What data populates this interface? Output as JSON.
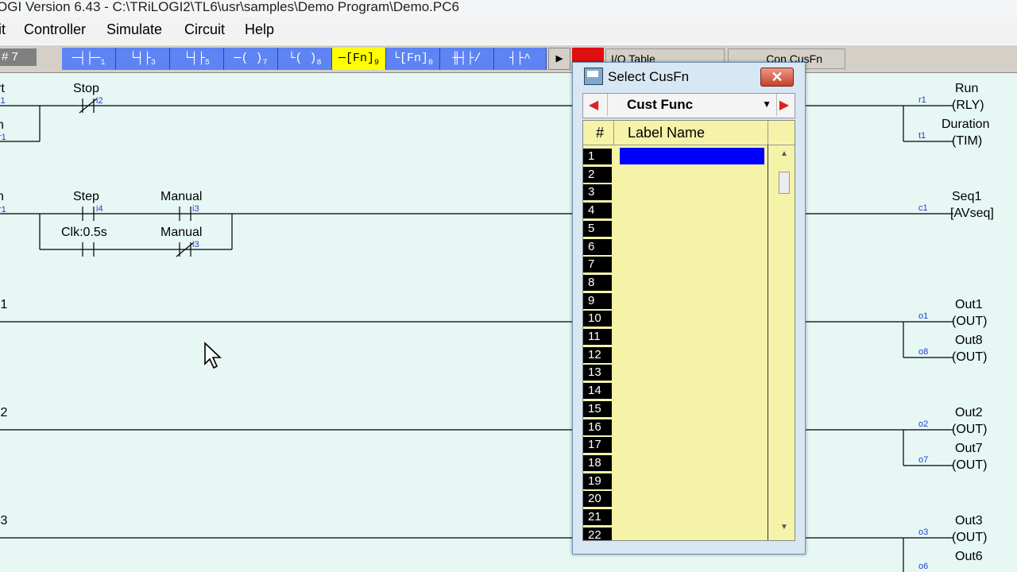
{
  "window": {
    "title": "OGI Version 6.43 - C:\\TRiLOGI2\\TL6\\usr\\samples\\Demo Program\\Demo.PC6"
  },
  "menu": {
    "items": [
      "it",
      "Controller",
      "Simulate",
      "Circuit",
      "Help"
    ]
  },
  "toolbar": {
    "rung_number": "# 7",
    "buttons": [
      {
        "label": "─┤├─",
        "sub": "1",
        "icon": "contact-series-icon"
      },
      {
        "label": "└┤├",
        "sub": "3",
        "icon": "contact-parallel-icon"
      },
      {
        "label": "└┤├",
        "sub": "5",
        "icon": "branch-contact-icon"
      },
      {
        "label": "─( )",
        "sub": "7",
        "icon": "coil-icon"
      },
      {
        "label": "└( )",
        "sub": "8",
        "icon": "parallel-coil-icon"
      },
      {
        "label": "─[Fn]",
        "sub": "9",
        "icon": "function-icon"
      },
      {
        "label": "└[Fn]",
        "sub": "0",
        "icon": "parallel-function-icon"
      },
      {
        "label": "╫┤├/",
        "sub": "",
        "icon": "nc-contact-icon"
      },
      {
        "label": "┤├^",
        "sub": "",
        "icon": "edge-contact-icon"
      }
    ],
    "play_icon": "play-icon",
    "io_table": "I/O Table",
    "cusfn": "CusFn",
    "cusfn_prefix": "Con"
  },
  "ladder": {
    "left_labels": [
      "rt",
      "n",
      "n",
      ":1",
      ":2",
      ":3"
    ],
    "left_addr": [
      "i1",
      "r1",
      "r1"
    ],
    "contacts": [
      {
        "name": "Stop",
        "addr": "i2"
      },
      {
        "name": "Step",
        "addr": "i4"
      },
      {
        "name": "Manual",
        "addr": "i3"
      },
      {
        "name": "Clk:0.5s",
        "addr": ""
      },
      {
        "name": "Manual",
        "addr": "i3"
      }
    ],
    "coils": [
      {
        "addr": "r1",
        "name": "Run",
        "type": "(RLY)"
      },
      {
        "addr": "t1",
        "name": "Duration",
        "type": "(TIM)"
      },
      {
        "addr": "c1",
        "name": "Seq1",
        "type": "[AVseq]"
      },
      {
        "addr": "o1",
        "name": "Out1",
        "type": "(OUT)"
      },
      {
        "addr": "o8",
        "name": "Out8",
        "type": "(OUT)"
      },
      {
        "addr": "o2",
        "name": "Out2",
        "type": "(OUT)"
      },
      {
        "addr": "o7",
        "name": "Out7",
        "type": "(OUT)"
      },
      {
        "addr": "o3",
        "name": "Out3",
        "type": "(OUT)"
      },
      {
        "addr": "o6",
        "name": "Out6",
        "type": "(OUT)"
      }
    ]
  },
  "dialog": {
    "title": "Select CusFn",
    "close": "✕",
    "combo_value": "Cust Func",
    "col_num": "#",
    "col_label": "Label Name",
    "rows": [
      "1",
      "2",
      "3",
      "4",
      "5",
      "6",
      "7",
      "8",
      "9",
      "10",
      "11",
      "12",
      "13",
      "14",
      "15",
      "16",
      "17",
      "18",
      "19",
      "20",
      "21",
      "22"
    ],
    "selected_index": 0,
    "colors": {
      "list_bg": "#f5f3a8",
      "selection": "#0000ff",
      "toolbar_button": "#5e83f2",
      "selected_tool": "#ffff00",
      "ladder_bg": "#e6f7f4"
    }
  }
}
